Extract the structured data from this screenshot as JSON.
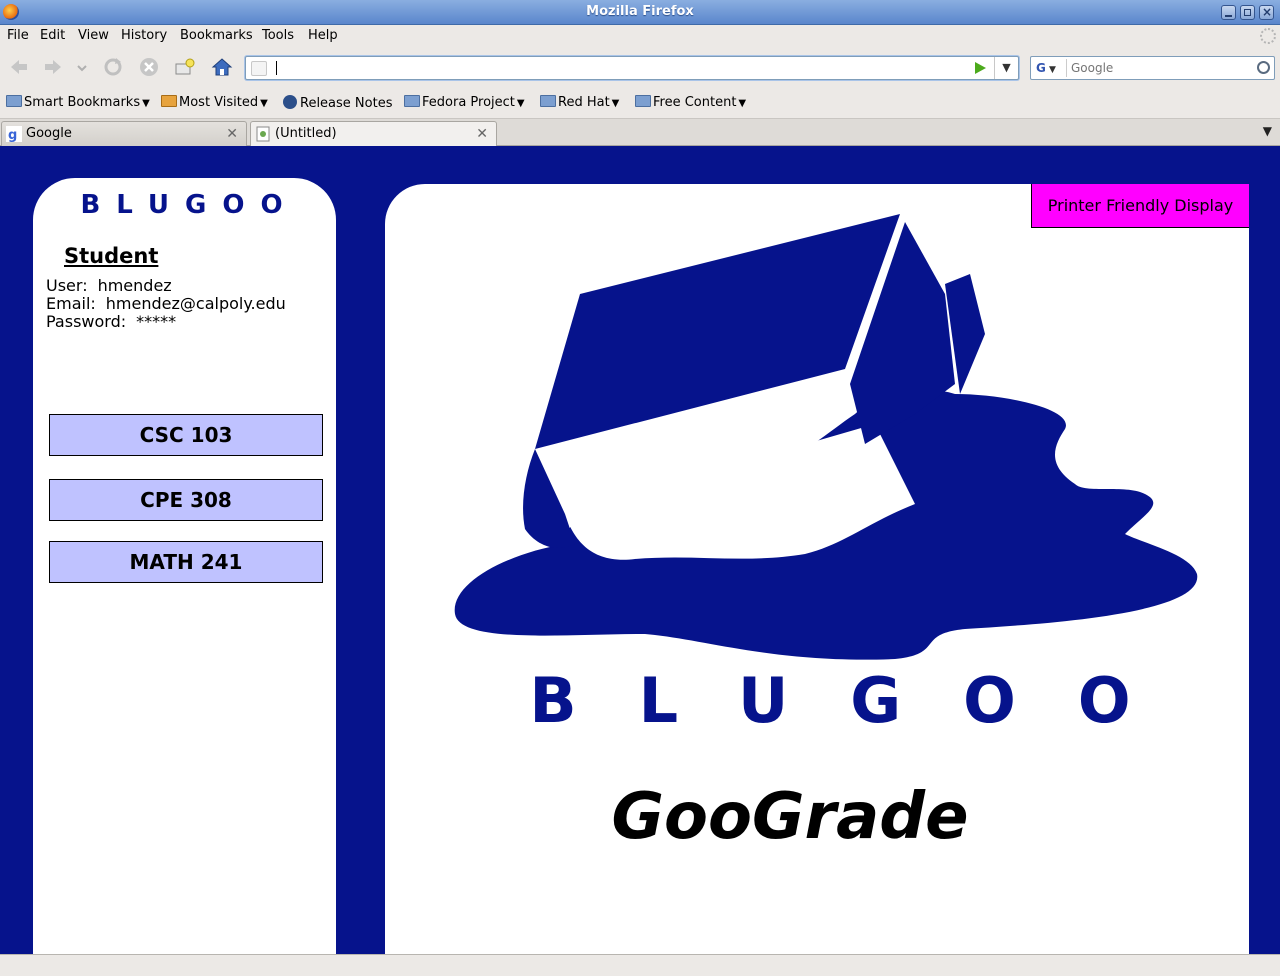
{
  "window": {
    "title": "Mozilla Firefox"
  },
  "menu": [
    {
      "label": "File"
    },
    {
      "label": "Edit"
    },
    {
      "label": "View"
    },
    {
      "label": "History"
    },
    {
      "label": "Bookmarks"
    },
    {
      "label": "Tools"
    },
    {
      "label": "Help"
    }
  ],
  "navbar": {
    "url_value": "",
    "search_placeholder": "Google",
    "search_engine_label": "G"
  },
  "bookmarks": [
    {
      "label": "Smart Bookmarks"
    },
    {
      "label": "Most Visited"
    },
    {
      "label": "Release Notes"
    },
    {
      "label": "Fedora Project"
    },
    {
      "label": "Red Hat"
    },
    {
      "label": "Free Content"
    }
  ],
  "tabs": [
    {
      "label": "Google"
    },
    {
      "label": "(Untitled)"
    }
  ],
  "sidebar": {
    "logo_text": "BLUGOO",
    "role": "Student",
    "user_label": "User:",
    "user_value": "hmendez",
    "email_label": "Email:",
    "email_value": "hmendez@calpoly.edu",
    "password_label": "Password:",
    "password_value": "*****",
    "courses": [
      {
        "label": "CSC 103"
      },
      {
        "label": "CPE 308"
      },
      {
        "label": "MATH 241"
      }
    ]
  },
  "main": {
    "print_button": "Printer Friendly Display",
    "brand_text": "BLUGOO",
    "app_name": "GooGrade"
  },
  "colors": {
    "page_background": "#06138c",
    "course_button": "#bfc2ff",
    "print_button": "#ff00ff"
  }
}
